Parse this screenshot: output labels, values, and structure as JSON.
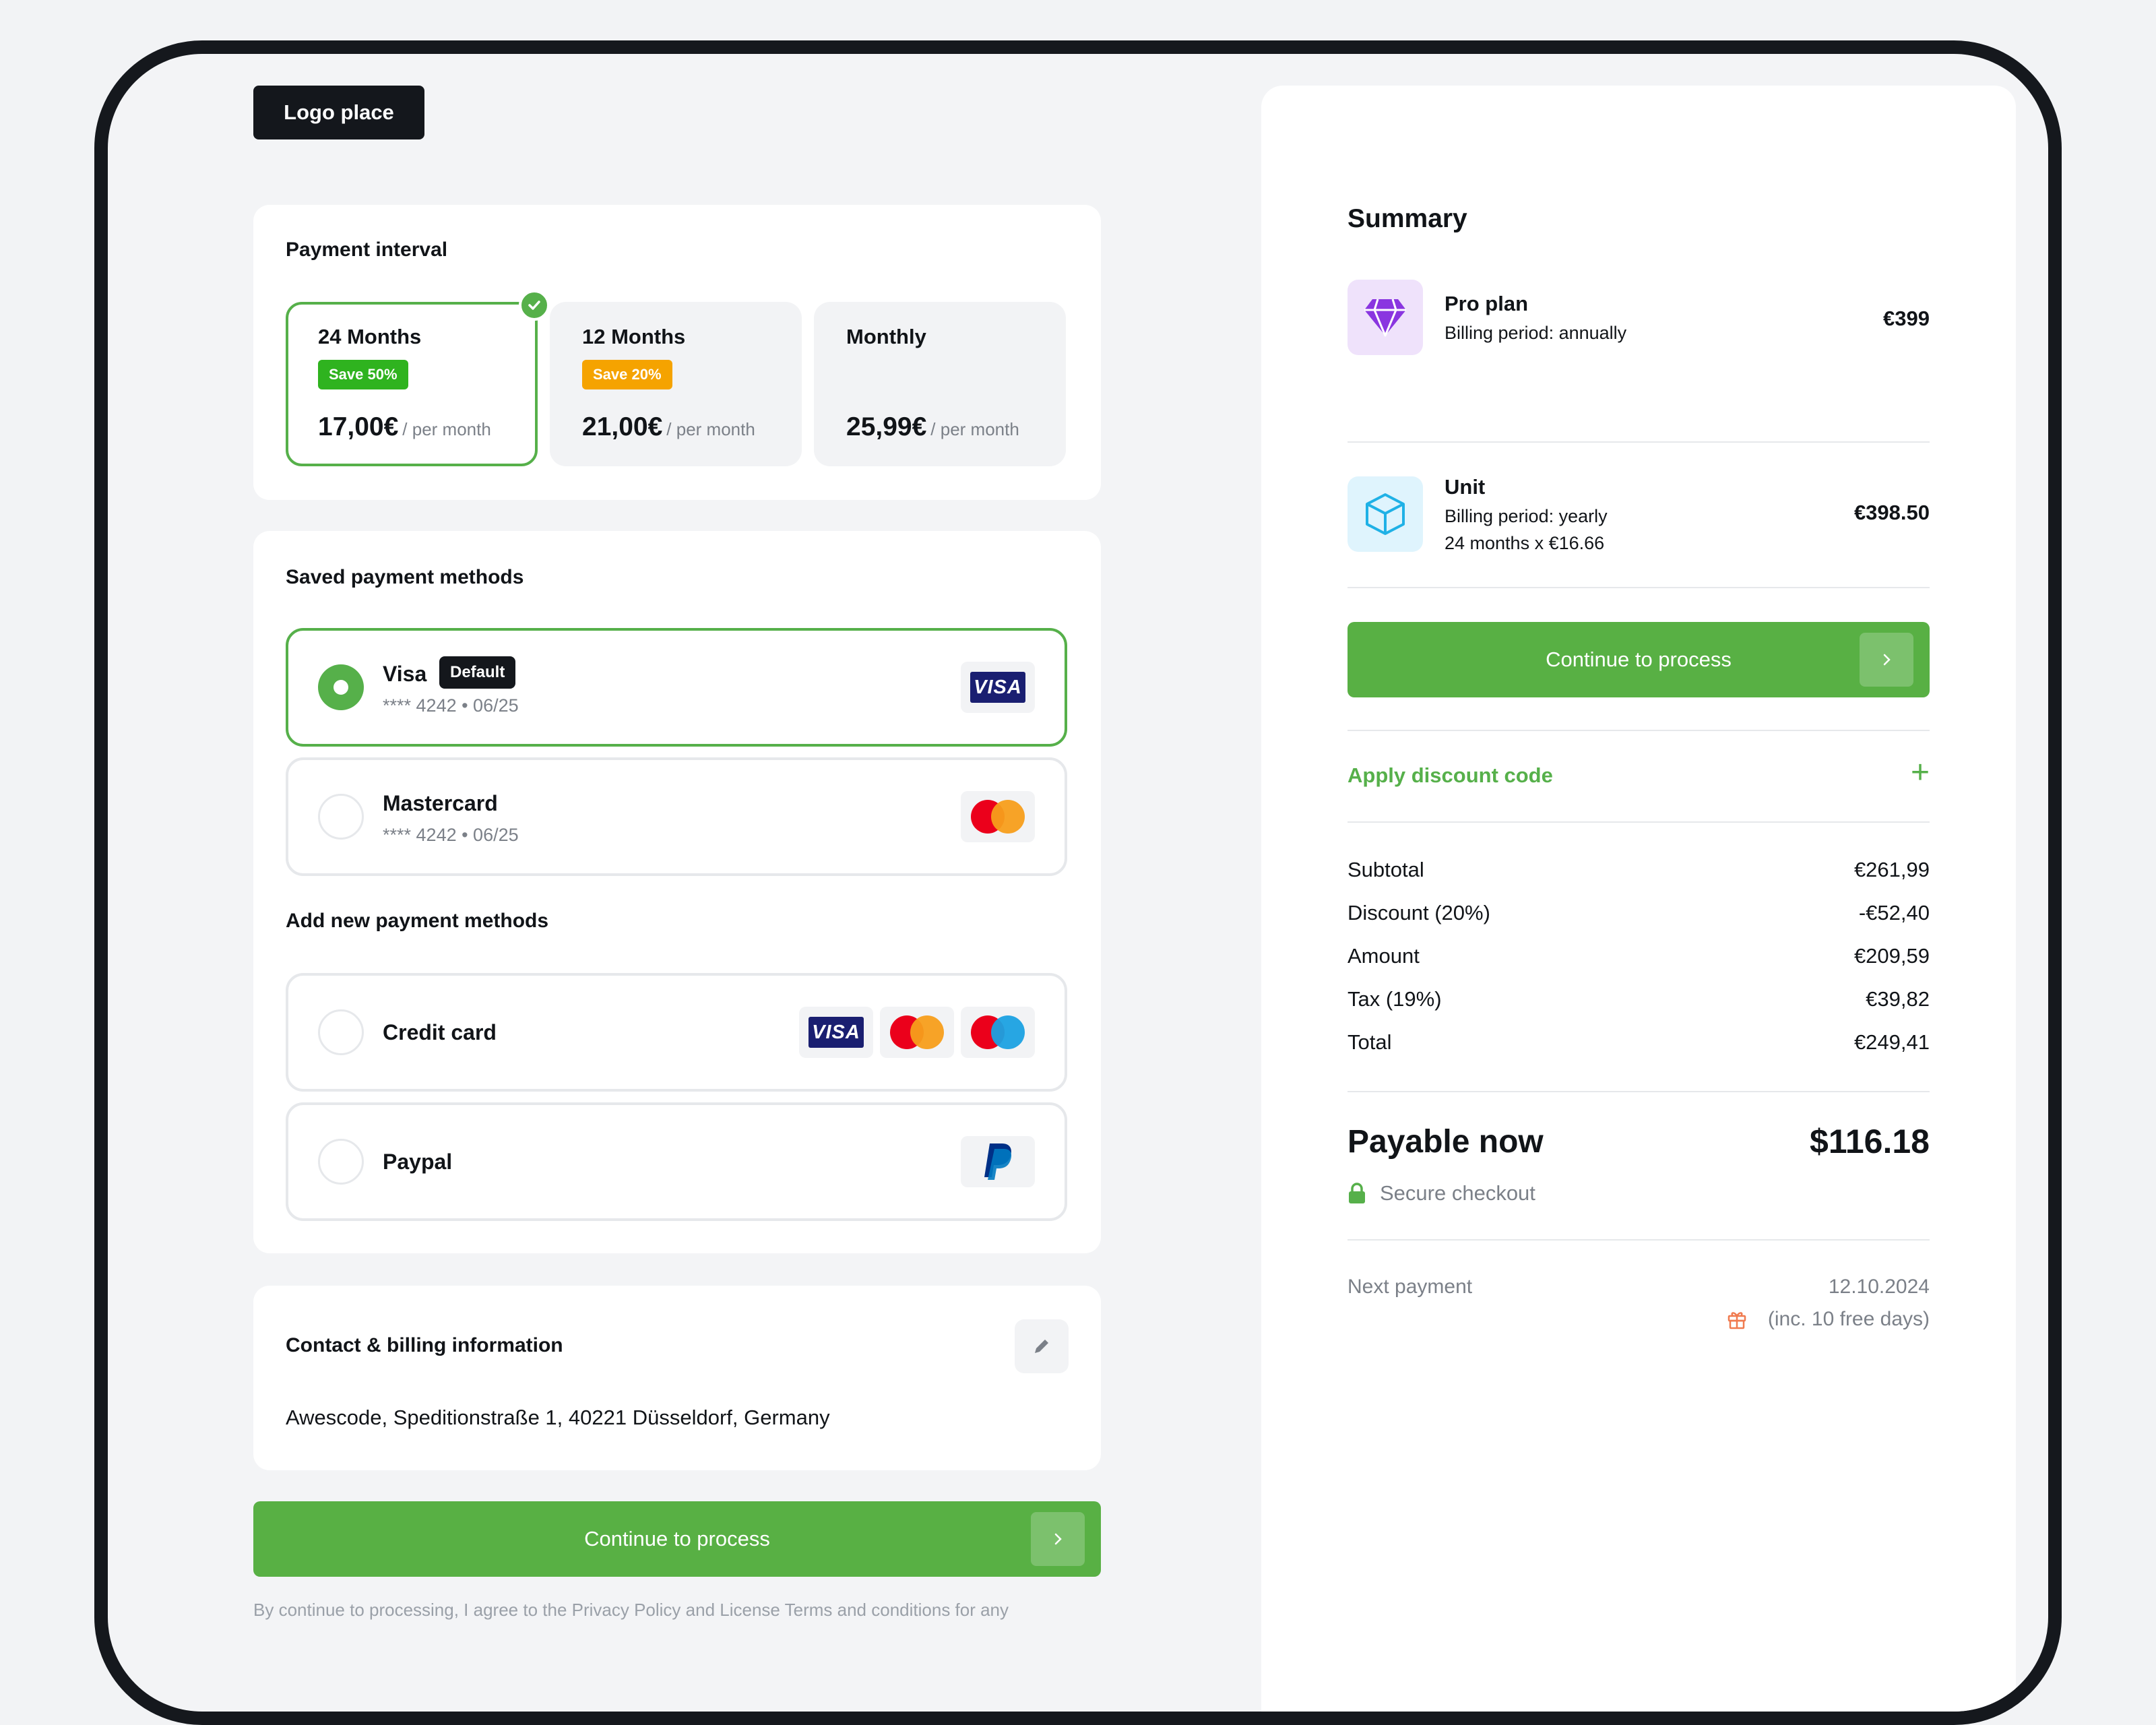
{
  "logo": {
    "label": "Logo place"
  },
  "interval": {
    "title": "Payment interval",
    "options": [
      {
        "name": "24 Months",
        "badge": "Save 50%",
        "badge_color": "#2fb31f",
        "price": "17,00€",
        "per": "/ per month",
        "selected": true
      },
      {
        "name": "12 Months",
        "badge": "Save 20%",
        "badge_color": "#f5a300",
        "price": "21,00€",
        "per": "/ per month",
        "selected": false
      },
      {
        "name": "Monthly",
        "badge": "",
        "price": "25,99€",
        "per": "/ per month",
        "selected": false
      }
    ]
  },
  "saved_methods": {
    "title": "Saved payment methods",
    "items": [
      {
        "name": "Visa",
        "badge": "Default",
        "detail": "**** 4242 • 06/25",
        "brand": "VISA",
        "selected": true
      },
      {
        "name": "Mastercard",
        "detail": "**** 4242 • 06/25",
        "brand": "mastercard-icon",
        "selected": false
      }
    ]
  },
  "new_methods": {
    "title": "Add new payment methods",
    "items": [
      {
        "name": "Credit card",
        "brands": [
          "VISA",
          "mastercard-icon",
          "maestro-icon"
        ]
      },
      {
        "name": "Paypal",
        "brands": [
          "paypal-icon"
        ]
      }
    ]
  },
  "contact": {
    "title": "Contact & billing information",
    "address": "Awescode, Speditionstraße 1, 40221 Düsseldorf, Germany"
  },
  "cta": {
    "label": "Continue to process"
  },
  "footnote": "By continue to processing, I agree to the Privacy Policy and License Terms and conditions for any",
  "summary": {
    "title": "Summary",
    "items": [
      {
        "name": "Pro plan",
        "lines": [
          "Billing period: annually"
        ],
        "price": "€399",
        "icon": "diamond-icon",
        "icon_bg": "#efe2fb"
      },
      {
        "name": "Unit",
        "lines": [
          "Billing period: yearly",
          "24 months x €16.66"
        ],
        "price": "€398.50",
        "icon": "cube-icon",
        "icon_bg": "#dff4fd"
      }
    ],
    "cta_label": "Continue to process",
    "discount_label": "Apply discount code",
    "rows": [
      {
        "label": "Subtotal",
        "value": "€261,99"
      },
      {
        "label": "Discount (20%)",
        "value": "-€52,40"
      },
      {
        "label": "Amount",
        "value": "€209,59"
      },
      {
        "label": "Tax (19%)",
        "value": "€39,82"
      },
      {
        "label": "Total",
        "value": "€249,41"
      }
    ],
    "payable_label": "Payable now",
    "payable_value": "$116.18",
    "secure_label": "Secure checkout",
    "next_payment_label": "Next payment",
    "next_payment_date": "12.10.2024",
    "free_days": "(inc. 10 free days)"
  },
  "colors": {
    "accent": "#56b04a",
    "dark": "#14171c",
    "muted": "#7b8088"
  }
}
